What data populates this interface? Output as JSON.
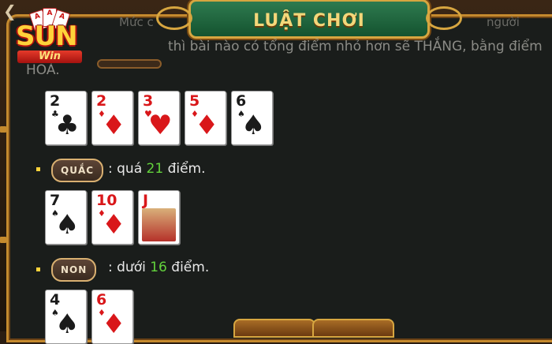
{
  "title": "LUẬT CHƠI",
  "logo": {
    "brand": "SUN",
    "ribbon": "Win"
  },
  "top_strip": {
    "left_text": "Mức c",
    "right_text": "người"
  },
  "intro_line": {
    "text": "thì bài nào có tổng điểm nhỏ hơn sẽ THẮNG, bằng điểm",
    "continued": "HOÀ."
  },
  "hand_1": [
    {
      "rank": "2",
      "suit": "♣",
      "color": "black"
    },
    {
      "rank": "2",
      "suit": "♦",
      "color": "red"
    },
    {
      "rank": "3",
      "suit": "♥",
      "color": "red"
    },
    {
      "rank": "5",
      "suit": "♦",
      "color": "red"
    },
    {
      "rank": "6",
      "suit": "♠",
      "color": "black"
    }
  ],
  "rule_quac": {
    "badge": "QUẮC",
    "prefix": ": quá",
    "number": "21",
    "suffix": "điểm."
  },
  "hand_2": [
    {
      "rank": "7",
      "suit": "♠",
      "color": "black"
    },
    {
      "rank": "10",
      "suit": "♦",
      "color": "red"
    },
    {
      "rank": "J",
      "suit": "♥",
      "color": "red",
      "face": true
    }
  ],
  "rule_non": {
    "badge": "NON",
    "prefix": ": dưới",
    "number": "16",
    "suffix": "điểm."
  },
  "hand_3": [
    {
      "rank": "4",
      "suit": "♠",
      "color": "black"
    },
    {
      "rank": "6",
      "suit": "♦",
      "color": "red"
    }
  ],
  "colors": {
    "accent_green": "#63d33c",
    "gold": "#d7a640",
    "panel_bg": "#1a1d1b"
  }
}
